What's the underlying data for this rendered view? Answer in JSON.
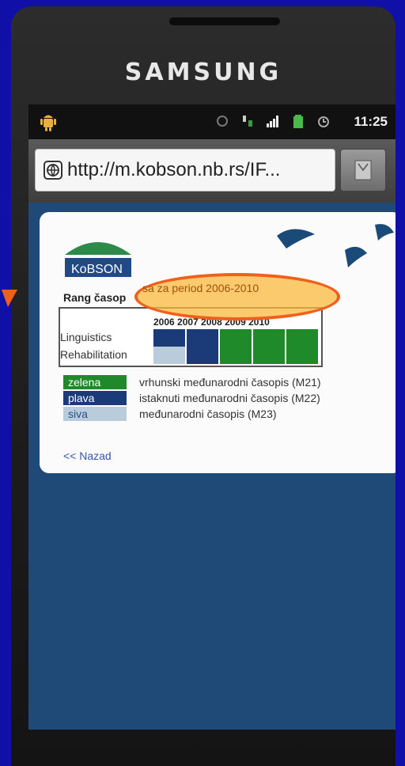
{
  "device": {
    "brand": "SAMSUNG"
  },
  "statusbar": {
    "time": "11:25"
  },
  "browser": {
    "url": "http://m.kobson.nb.rs/IF..."
  },
  "page": {
    "logo_text": "KoBSON",
    "rank_title_prefix": "Rang časop",
    "rank_title_highlight": "sa za period 2006-2010",
    "years": [
      "2006",
      "2007",
      "2008",
      "2009",
      "2010"
    ],
    "years_label": "2006 2007 2008 2009 2010",
    "rows": [
      {
        "label": "Linguistics",
        "cells": [
          "plava",
          "plava",
          "zelena",
          "zelena",
          "zelena"
        ]
      },
      {
        "label": "Rehabilitation",
        "cells": [
          "siva",
          "plava",
          "zelena",
          "zelena",
          "zelena"
        ]
      }
    ],
    "legend": [
      {
        "swatch": "zelena",
        "description": "vrhunski međunarodni časopis (M21)",
        "color": "#1e8a2a"
      },
      {
        "swatch": "plava",
        "description": "istaknuti međunarodni časopis (M22)",
        "color": "#1b3a78"
      },
      {
        "swatch": "siva",
        "description": "međunarodni časopis (M23)",
        "color": "#b9ccdb"
      }
    ],
    "back_link": "<< Nazad"
  },
  "colors": {
    "zelena": "#1e8a2a",
    "plava": "#1b3a78",
    "siva": "#b9ccdb",
    "highlight": "#f0601c"
  },
  "icons": [
    "android-icon",
    "sync-icon",
    "download-icon",
    "signal-icon",
    "battery-icon",
    "alarm-icon",
    "globe-icon",
    "bookmark-icon"
  ]
}
